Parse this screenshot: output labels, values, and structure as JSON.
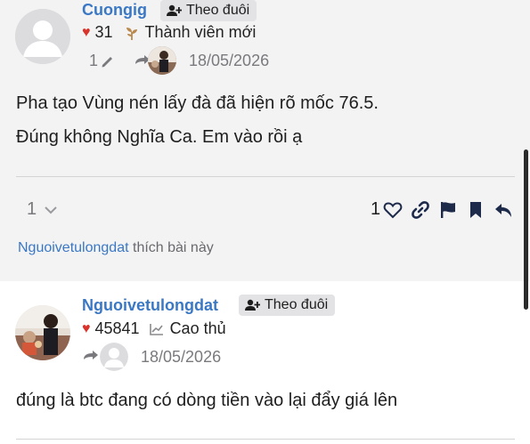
{
  "posts": [
    {
      "username": "Cuongig",
      "follow_label": "Theo đuôi",
      "likes": "31",
      "rank": "Thành viên mới",
      "edits": "1",
      "date": "18/05/2026",
      "body_lines": [
        "Pha tạo Vùng nén lấy đà đã hiện rõ mốc 76.5.",
        "Đúng không Nghĩa Ca. Em vào rồi ạ"
      ],
      "replies_count": "1",
      "like_count": "1",
      "liked_by_user": "Nguoivetulongdat",
      "liked_by_suffix": "thích bài này"
    },
    {
      "username": "Nguoivetulongdat",
      "follow_label": "Theo đuôi",
      "likes": "45841",
      "rank": "Cao thủ",
      "date": "18/05/2026",
      "body_lines": [
        "đúng là btc đang có dòng tiền vào lại đẩy giá lên"
      ]
    }
  ],
  "colors": {
    "username": "#3b78c4",
    "heart": "#d9342b",
    "post_bg_highlight": "#f3f3f4",
    "action_icons": "#1d2a4a"
  },
  "icons": {
    "follow": "person-plus-icon",
    "heart": "heart-icon",
    "rank_new": "sprout-icon",
    "rank_pro": "chart-trend-icon",
    "edit": "pencil-icon",
    "reply_to": "reply-arrow-icon",
    "like": "heart-outline-icon",
    "link": "link-icon",
    "flag": "flag-icon",
    "bookmark": "bookmark-icon",
    "reply": "reply-icon"
  }
}
